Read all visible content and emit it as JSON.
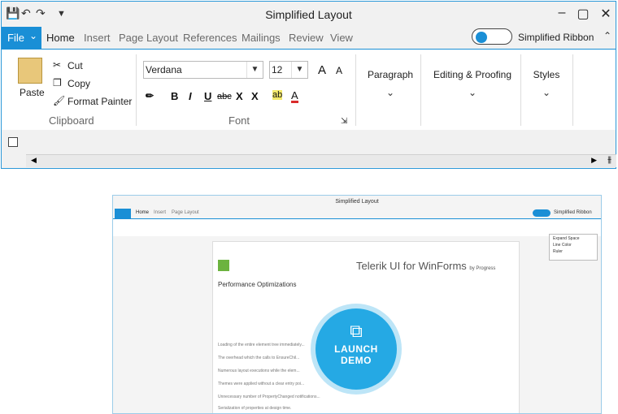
{
  "window": {
    "title": "Simplified Layout",
    "tabs": [
      {
        "label": "File",
        "active": false
      },
      {
        "label": "Home",
        "active": true
      },
      {
        "label": "Insert",
        "active": false
      },
      {
        "label": "Page Layout",
        "active": false
      },
      {
        "label": "References",
        "active": false
      },
      {
        "label": "Mailings",
        "active": false
      },
      {
        "label": "Review",
        "active": false
      },
      {
        "label": "View",
        "active": false
      }
    ],
    "simplified_ribbon_label": "Simplified Ribbon",
    "simplified_ribbon_on": false,
    "accent": "#1a8fd6"
  },
  "clipboard": {
    "paste": "Paste",
    "cut": "Cut",
    "copy": "Copy",
    "format_painter": "Format Painter",
    "group_label": "Clipboard"
  },
  "font": {
    "family": "Verdana",
    "size": "12",
    "grow": "A",
    "shrink": "A",
    "bold": "B",
    "italic": "I",
    "underline": "U",
    "strike": "abc",
    "subscript": "X",
    "superscript": "X",
    "highlight": "ab",
    "color": "A",
    "group_label": "Font"
  },
  "groups": {
    "paragraph": "Paragraph",
    "editing": "Editing & Proofing",
    "styles": "Styles"
  },
  "demo": {
    "title": "Simplified Layout",
    "tabs": [
      "Home",
      "Insert",
      "Page Layout"
    ],
    "simplified_ribbon_label": "Simplified Ribbon",
    "brand": "Telerik UI for WinForms",
    "brand_by": "by Progress",
    "heading": "Performance Optimizations",
    "menu": [
      "Expand Space",
      "Line Color",
      "Ruler"
    ],
    "bullets": [
      "Loading of the entire element tree immediately...",
      "The overhead which the calls to EnsureChil...",
      "Numerous layout executions while the elem...",
      "Themes were applied without a clear entry poi...",
      "Unnecessary number of PropertyChanged notifications...",
      "Element tree layouts and PropertyChanged notifications running during the Dropping stage.",
      "Serialization of properties at design time."
    ],
    "launch_line1": "LAUNCH",
    "launch_line2": "DEMO",
    "launch_color": "#25a9e4"
  }
}
